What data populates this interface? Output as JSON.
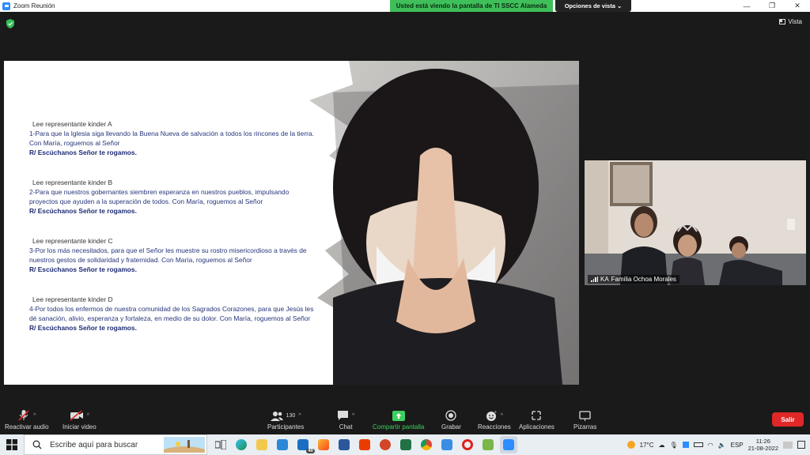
{
  "window": {
    "title": "Zoom Reunión"
  },
  "banner": {
    "sharing_text": "Usted está viendo la pantalla de TI SSCC Alameda",
    "view_options": "Opciones de vista"
  },
  "view_button": "Vista",
  "slide": {
    "blocks": [
      {
        "reader": "Lee representante kinder A",
        "prayer": "1-Para que la Iglesia siga llevando la Buena Nueva de salvación a todos los rincones de la tierra. Con María, roguemos al Señor",
        "response": "R/ Escúchanos Señor te rogamos."
      },
      {
        "reader": "Lee representante kinder B",
        "prayer": "2-Para que nuestros gobernantes siembren esperanza en nuestros pueblos, impulsando proyectos que ayuden a la superación de todos. Con María, roguemos al Señor",
        "response": "R/ Escúchanos Señor te rogamos."
      },
      {
        "reader": "Lee representante kinder C",
        "prayer": "3-Por los más necesitados, para que el Señor les muestre su rostro   misericordioso a través de nuestros gestos de solidaridad y fraternidad. Con María, roguemos al Señor",
        "response": "R/ Escúchanos Señor te rogamos."
      },
      {
        "reader": "Lee representante kinder D",
        "prayer": "4-Por todos los enfermos de nuestra comunidad de los Sagrados Corazones, para que Jesús les dé sanación, alivio, esperanza y fortaleza, en medio de su dolor. Con María, roguemos al Señor",
        "response": "R/ Escúchanos Señor te rogamos."
      }
    ]
  },
  "participant": {
    "initials": "KA",
    "name": "Familia Ochoa Morales"
  },
  "toolbar": {
    "mute": "Reactivar audio",
    "video": "Iniciar video",
    "participants": "Participantes",
    "participants_count": "130",
    "chat": "Chat",
    "share": "Compartir pantalla",
    "record": "Grabar",
    "reactions": "Reacciones",
    "apps": "Aplicaciones",
    "whiteboards": "Pizarras",
    "leave": "Salir"
  },
  "taskbar": {
    "search_placeholder": "Escribe aquí para buscar",
    "mail_badge": "40",
    "temperature": "17°C",
    "language": "ESP",
    "time": "11:26",
    "date": "21-08-2022"
  },
  "colors": {
    "share_green": "#3fbf5a",
    "leave_red": "#e02828",
    "prayer_text": "#27357a"
  }
}
